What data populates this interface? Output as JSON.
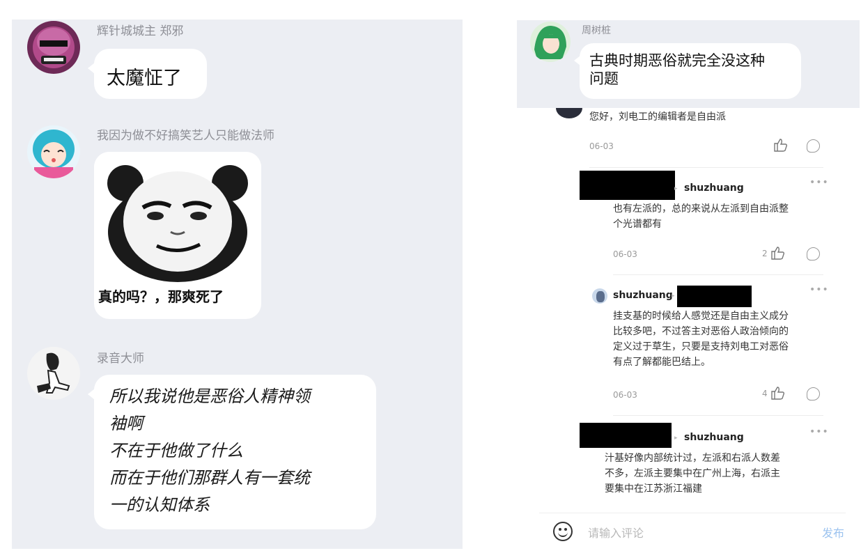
{
  "left_chat": {
    "messages": [
      {
        "sender": "辉针城城主 郑邪",
        "text": "太魔怔了"
      },
      {
        "sender": "我因为做不好搞笑艺人只能做法师",
        "sticker_caption": "真的吗？，那爽死了"
      },
      {
        "sender": "录音大师",
        "lines": [
          "所以我说他是恶俗人精神领",
          "袖啊",
          "不在于他做了什么",
          "而在于他们那群人有一套统",
          "一的认知体系"
        ]
      }
    ]
  },
  "right_panel": {
    "top_message": {
      "sender": "周树桩",
      "text_line1": "古典时期恶俗就完全没这种",
      "text_line2": "问题"
    },
    "comments": [
      {
        "text": "您好，刘电工的编辑者是自由派",
        "date": "06-03"
      },
      {
        "reply_to": "shuzhuang",
        "text_line1": "也有左派的，总的来说从左派到自由派整",
        "text_line2": "个光谱都有",
        "date": "06-03",
        "likes": "2"
      },
      {
        "author": "shuzhuang",
        "text_lines": [
          "挂支基的时候给人感觉还是自由主义成分",
          "比较多吧，不过答主对恶俗人政治倾向的",
          "定义过于草生，只要是支持刘电工对恶俗",
          "有点了解都能巴结上。"
        ],
        "date": "06-03",
        "likes": "4"
      },
      {
        "reply_to": "shuzhuang",
        "text_lines": [
          "汁基好像内部统计过，左派和右派人数差",
          "不多，左派主要集中在广州上海，右派主",
          "要集中在江苏浙江福建"
        ]
      }
    ],
    "more": "•••",
    "input": {
      "placeholder": "请输入评论",
      "send_label": "发布"
    }
  }
}
